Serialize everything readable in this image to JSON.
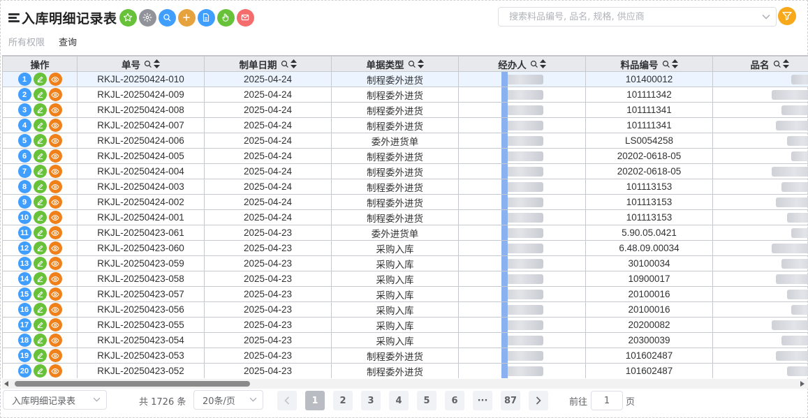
{
  "header": {
    "title": "入库明细记录表",
    "buttons": [
      {
        "name": "favorite-button",
        "icon": "star-icon",
        "color": "#67c23a"
      },
      {
        "name": "settings-button",
        "icon": "gear-icon",
        "color": "#909399"
      },
      {
        "name": "search-button",
        "icon": "search-icon",
        "color": "#409eff"
      },
      {
        "name": "add-button",
        "icon": "plus-icon",
        "color": "#e6a23c"
      },
      {
        "name": "export-button",
        "icon": "document-icon",
        "color": "#409eff"
      },
      {
        "name": "approve-button",
        "icon": "hand-icon",
        "color": "#67c23a"
      },
      {
        "name": "delete-button",
        "icon": "close-icon",
        "color": "#f56c6c"
      }
    ],
    "search_placeholder": "搜索料品编号, 品名, 规格, 供应商",
    "filter_color": "#f7a81b"
  },
  "tabs": {
    "permission": "所有权限",
    "query": "查询"
  },
  "table": {
    "columns": {
      "ops": "操作",
      "order_no": "单号",
      "date": "制单日期",
      "doc_type": "单据类型",
      "handler": "经办人",
      "item_no": "料品编号",
      "item_name": "品名"
    },
    "rows": [
      {
        "idx": "1",
        "order_no": "RKJL-20250424-010",
        "date": "2025-04-24",
        "doc_type": "制程委外进货",
        "item_no": "101400012",
        "selected": true
      },
      {
        "idx": "2",
        "order_no": "RKJL-20250424-009",
        "date": "2025-04-24",
        "doc_type": "制程委外进货",
        "item_no": "101111342"
      },
      {
        "idx": "3",
        "order_no": "RKJL-20250424-008",
        "date": "2025-04-24",
        "doc_type": "制程委外进货",
        "item_no": "101111341"
      },
      {
        "idx": "4",
        "order_no": "RKJL-20250424-007",
        "date": "2025-04-24",
        "doc_type": "制程委外进货",
        "item_no": "101111341"
      },
      {
        "idx": "5",
        "order_no": "RKJL-20250424-006",
        "date": "2025-04-24",
        "doc_type": "委外进货单",
        "item_no": "LS0054258"
      },
      {
        "idx": "6",
        "order_no": "RKJL-20250424-005",
        "date": "2025-04-24",
        "doc_type": "制程委外进货",
        "item_no": "20202-0618-05"
      },
      {
        "idx": "7",
        "order_no": "RKJL-20250424-004",
        "date": "2025-04-24",
        "doc_type": "制程委外进货",
        "item_no": "20202-0618-05"
      },
      {
        "idx": "8",
        "order_no": "RKJL-20250424-003",
        "date": "2025-04-24",
        "doc_type": "制程委外进货",
        "item_no": "101113153"
      },
      {
        "idx": "9",
        "order_no": "RKJL-20250424-002",
        "date": "2025-04-24",
        "doc_type": "制程委外进货",
        "item_no": "101113153"
      },
      {
        "idx": "10",
        "order_no": "RKJL-20250424-001",
        "date": "2025-04-24",
        "doc_type": "制程委外进货",
        "item_no": "101113153"
      },
      {
        "idx": "11",
        "order_no": "RKJL-20250423-061",
        "date": "2025-04-23",
        "doc_type": "委外进货单",
        "item_no": "5.90.05.0421"
      },
      {
        "idx": "12",
        "order_no": "RKJL-20250423-060",
        "date": "2025-04-23",
        "doc_type": "采购入库",
        "item_no": "6.48.09.00034"
      },
      {
        "idx": "13",
        "order_no": "RKJL-20250423-059",
        "date": "2025-04-23",
        "doc_type": "采购入库",
        "item_no": "30100034"
      },
      {
        "idx": "14",
        "order_no": "RKJL-20250423-058",
        "date": "2025-04-23",
        "doc_type": "采购入库",
        "item_no": "10900017"
      },
      {
        "idx": "15",
        "order_no": "RKJL-20250423-057",
        "date": "2025-04-23",
        "doc_type": "采购入库",
        "item_no": "20100016"
      },
      {
        "idx": "16",
        "order_no": "RKJL-20250423-056",
        "date": "2025-04-23",
        "doc_type": "采购入库",
        "item_no": "20100016"
      },
      {
        "idx": "17",
        "order_no": "RKJL-20250423-055",
        "date": "2025-04-23",
        "doc_type": "采购入库",
        "item_no": "20200082"
      },
      {
        "idx": "18",
        "order_no": "RKJL-20250423-054",
        "date": "2025-04-23",
        "doc_type": "采购入库",
        "item_no": "20300039"
      },
      {
        "idx": "19",
        "order_no": "RKJL-20250423-053",
        "date": "2025-04-23",
        "doc_type": "制程委外进货",
        "item_no": "101602487"
      },
      {
        "idx": "20",
        "order_no": "RKJL-20250423-052",
        "date": "2025-04-23",
        "doc_type": "制程委外进货",
        "item_no": "101602487"
      }
    ]
  },
  "footer": {
    "report_select": "入库明细记录表",
    "total": "共 1726 条",
    "page_size": "20条/页",
    "pages": [
      "1",
      "2",
      "3",
      "4",
      "5",
      "6",
      "···",
      "87"
    ],
    "current_page": "1",
    "goto_label": "前往",
    "goto_value": "1",
    "page_unit": "页"
  }
}
